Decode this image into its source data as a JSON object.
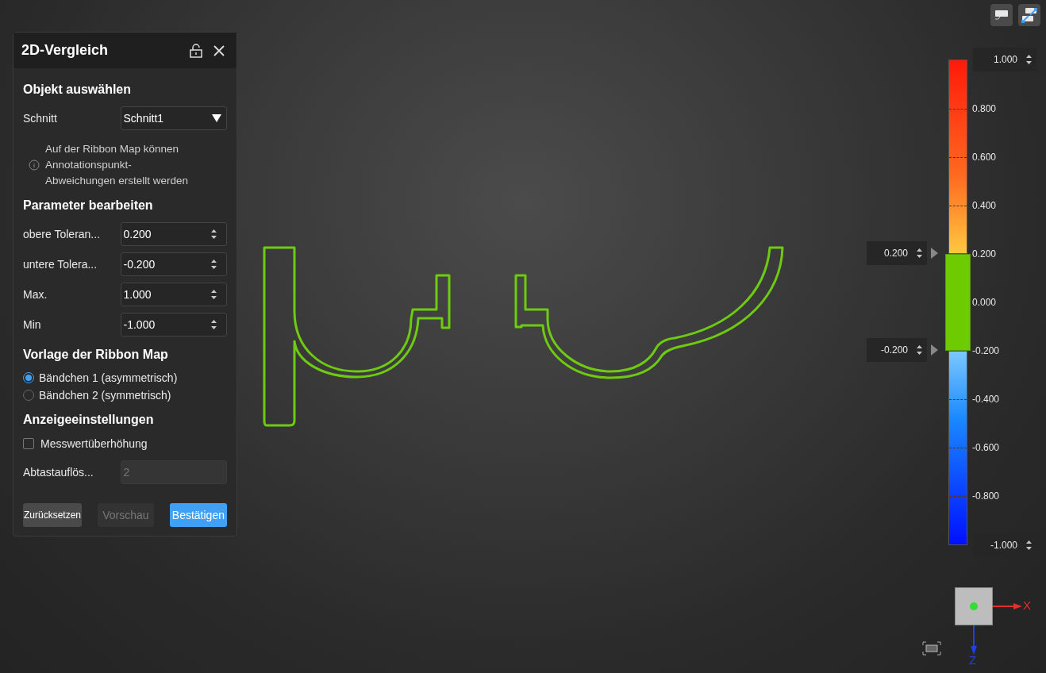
{
  "panel": {
    "title": "2D-Vergleich",
    "sections": [
      {
        "heading": "Objekt auswählen",
        "rows": [
          {
            "kind": "select",
            "label": "Schnitt",
            "value": "Schnitt1"
          },
          {
            "kind": "info",
            "text": "Auf der Ribbon Map können Annotationspunkt-Abweichungen erstellt werden"
          }
        ]
      },
      {
        "heading": "Parameter bearbeiten",
        "rows": [
          {
            "kind": "spin",
            "label": "obere Toleran...",
            "value": "0.200"
          },
          {
            "kind": "spin",
            "label": "untere Tolera...",
            "value": "-0.200"
          },
          {
            "kind": "spin",
            "label": "Max.",
            "value": "1.000"
          },
          {
            "kind": "spin",
            "label": "Min",
            "value": "-1.000"
          }
        ]
      },
      {
        "heading": "Vorlage der Ribbon Map",
        "rows": [
          {
            "kind": "radio",
            "label": "Bändchen 1 (asymmetrisch)",
            "selected": true
          },
          {
            "kind": "radio",
            "label": "Bändchen 2 (symmetrisch)",
            "selected": false
          }
        ]
      },
      {
        "heading": "Anzeigeeinstellungen",
        "rows": [
          {
            "kind": "checkbox",
            "label": "Messwertüberhöhung",
            "checked": false
          },
          {
            "kind": "text",
            "label": "Abtastauflös...",
            "value": "2",
            "disabled": true
          }
        ]
      }
    ],
    "buttons": [
      {
        "label": "Zurücksetzen",
        "kind": "secondary",
        "disabled": false
      },
      {
        "label": "Vorschau",
        "kind": "secondary",
        "disabled": true
      },
      {
        "label": "Bestätigen",
        "kind": "primary",
        "disabled": false
      }
    ]
  },
  "scale": {
    "max": "1.000",
    "min": "-1.000",
    "upper": "0.200",
    "lower": "-0.200",
    "ticks": [
      "0.800",
      "0.600",
      "0.400",
      "0.200",
      "0.000",
      "-0.200",
      "-0.400",
      "-0.600",
      "-0.800"
    ]
  },
  "axes": [
    "X",
    "Z"
  ]
}
